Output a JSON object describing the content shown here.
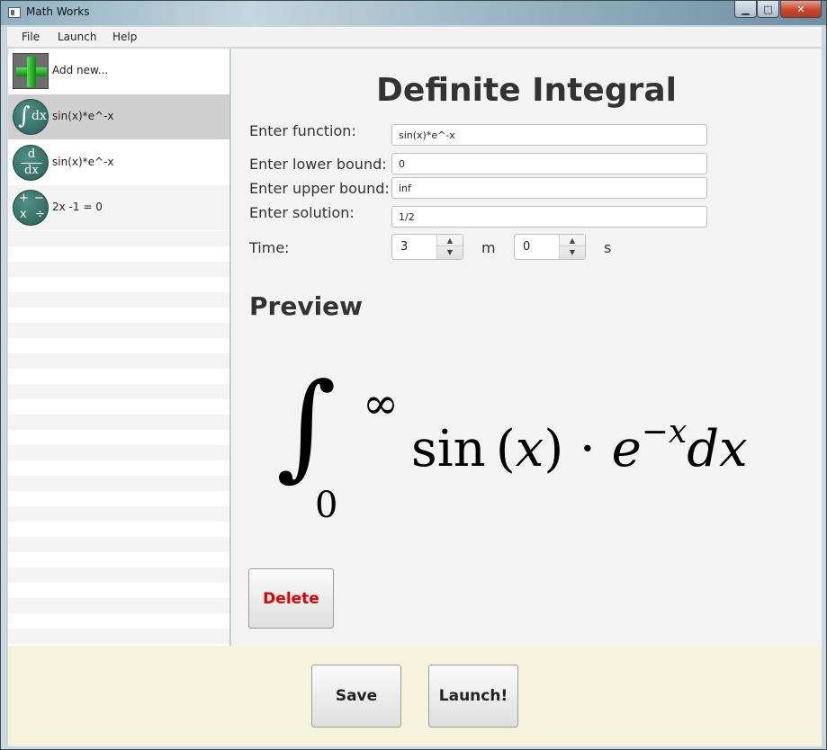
{
  "window": {
    "title": "Math Works",
    "minimize_glyph": "▁",
    "maximize_glyph": "□",
    "close_glyph": "✕"
  },
  "menu": {
    "items": [
      "File",
      "Launch",
      "Help"
    ]
  },
  "sidebar": {
    "items": [
      {
        "label": "Add new...",
        "icon": "add-icon"
      },
      {
        "label": "sin(x)*e^-x",
        "icon": "integral-icon",
        "selected": true,
        "icon_text": "∫",
        "icon_sub": "dx"
      },
      {
        "label": "sin(x)*e^-x",
        "icon": "derivative-icon",
        "icon_top": "d",
        "icon_bottom": "dx"
      },
      {
        "label": "2x -1 = 0",
        "icon": "operators-icon",
        "icon_ops": [
          "+",
          "−",
          "x",
          "÷"
        ]
      }
    ]
  },
  "main": {
    "title": "Definite Integral",
    "fields": {
      "function": {
        "label": "Enter function:",
        "value": "sin(x)*e^-x"
      },
      "lower": {
        "label": "Enter lower bound:",
        "value": "0"
      },
      "upper": {
        "label": "Enter upper bound:",
        "value": "inf"
      },
      "solution": {
        "label": "Enter solution:",
        "value": "1/2"
      }
    },
    "time": {
      "label": "Time:",
      "minutes": "3",
      "minutes_unit": "m",
      "seconds": "0",
      "seconds_unit": "s",
      "up_glyph": "▲",
      "down_glyph": "▼"
    },
    "preview": {
      "title": "Preview",
      "formula": {
        "integral": "∫",
        "upper": "∞",
        "lower": "0",
        "func": "sin",
        "paren_open": "(",
        "var": "x",
        "paren_close": ")",
        "dot": "·",
        "base": "e",
        "exponent": "−x",
        "differential": "dx"
      }
    },
    "delete_label": "Delete"
  },
  "footer": {
    "save_label": "Save",
    "launch_label": "Launch!"
  },
  "colors": {
    "delete_text": "#e00000",
    "footer_bg": "#f5f3dc",
    "selected_row": "#cfcfcf",
    "icon_green": "#2a5e55"
  }
}
